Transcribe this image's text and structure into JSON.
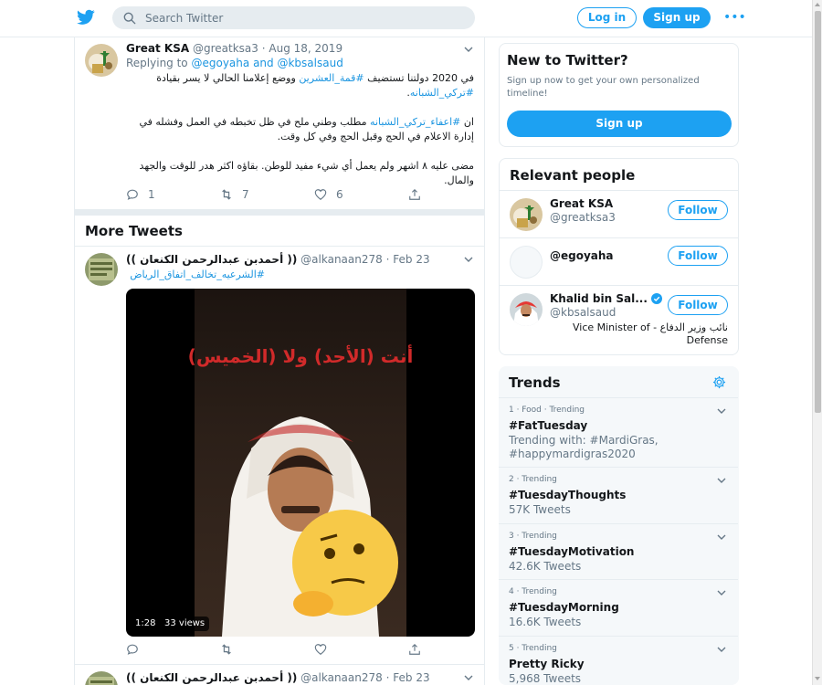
{
  "header": {
    "search_placeholder": "Search Twitter",
    "login_label": "Log in",
    "signup_label": "Sign up",
    "more_label": "•••"
  },
  "tweet1": {
    "name": "Great KSA",
    "handle": "@greatksa3",
    "date": "Aug 18, 2019",
    "replying_prefix": "Replying to",
    "replying_to_1": "@egoyaha",
    "replying_and": "and",
    "replying_to_2": "@kbsalsaud",
    "p1_text_a": "في 2020 دولتنا تستضيف ",
    "p1_hashtag_1": "#قمة_العشرين",
    "p1_text_b": " ووضع إعلامنا الحالي لا يسر بقيادة",
    "p1_hashtag_2": "#تركي_الشبانه",
    "p1_text_c": ".",
    "p2_text_a": "ان ",
    "p2_hashtag": "#اعفاء_تركي_الشبانه",
    "p2_text_b": " مطلب وطني ملح في ظل تخبطه في العمل وفشله في",
    "p2_line2": "إدارة الاعلام في الحج وقبل الحج وفي كل وقت.",
    "p3_line1": "مضى عليه ٨ اشهر ولم يعمل أي شيء مفيد للوطن. بقاؤه اكثر هدر للوقت والجهد",
    "p3_line2": "والمال.",
    "replies": "1",
    "retweets": "7",
    "likes": "6"
  },
  "more_tweets_label": "More Tweets",
  "tweet2": {
    "name": "(( أحمدبن عبدالرحمن الكنعان ))",
    "handle": "@alkanaan278",
    "date": "Feb 23",
    "hashtag": "#الشرعيه_تخالف_اتفاق_الرياض",
    "video_caption": "أنت (الأحد) ولا (الخميس)",
    "video_duration": "1:28",
    "video_views": "33 views"
  },
  "tweet3": {
    "name": "(( أحمدبن عبدالرحمن الكنعان ))",
    "handle": "@alkanaan278",
    "date": "Feb 23"
  },
  "new_to_twitter": {
    "title": "New to Twitter?",
    "subtitle": "Sign up now to get your own personalized timeline!",
    "button": "Sign up"
  },
  "relevant_people": {
    "title": "Relevant people",
    "people": [
      {
        "name": "Great KSA",
        "handle": "@greatksa3",
        "button": "Follow"
      },
      {
        "name": "",
        "handle": "@egoyaha",
        "button": "Follow"
      },
      {
        "name": "Khalid bin Sal...",
        "handle": "@kbsalsaud",
        "button": "Follow",
        "bio": "نائب وزير الدفاع - Vice Minister of Defense"
      }
    ]
  },
  "trends": {
    "title": "Trends",
    "items": [
      {
        "meta": "1 · Food · Trending",
        "name": "#FatTuesday",
        "count": "Trending with: #MardiGras, #happymardigras2020"
      },
      {
        "meta": "2 · Trending",
        "name": "#TuesdayThoughts",
        "count": "57K Tweets"
      },
      {
        "meta": "3 · Trending",
        "name": "#TuesdayMotivation",
        "count": "42.6K Tweets"
      },
      {
        "meta": "4 · Trending",
        "name": "#TuesdayMorning",
        "count": "16.6K Tweets"
      },
      {
        "meta": "5 · Trending",
        "name": "Pretty Ricky",
        "count": "5,968 Tweets"
      }
    ]
  },
  "colors": {
    "brand": "#1da1f2",
    "link": "#1b95e0",
    "muted": "#657786",
    "text": "#14171a",
    "border": "#e6ecf0",
    "caption_red": "#d12a2a"
  },
  "icons": {
    "logo": "twitter-bird-icon",
    "search": "search-icon",
    "reply": "reply-icon",
    "retweet": "retweet-icon",
    "like": "heart-icon",
    "share": "share-icon",
    "settings": "gear-icon",
    "verified": "verified-badge-icon"
  }
}
